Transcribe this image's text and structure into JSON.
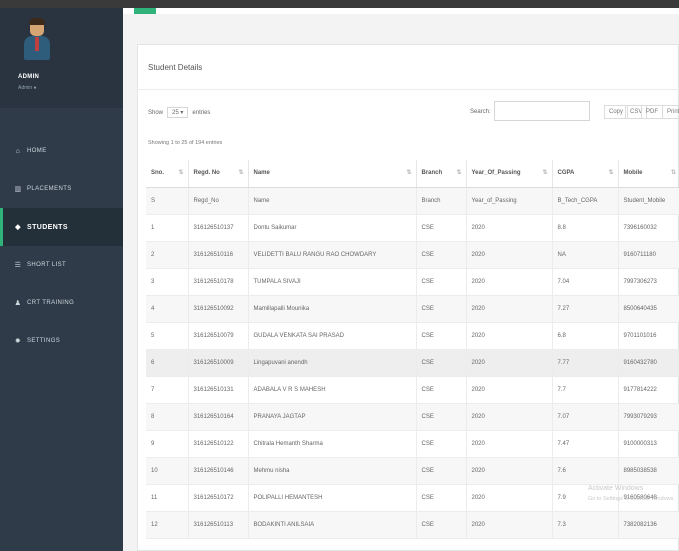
{
  "sidebar": {
    "profile": {
      "name": "ADMIN",
      "subtitle": "Admin ●"
    },
    "items": [
      {
        "label": "HOME",
        "icon": "home-icon",
        "glyph": "⌂"
      },
      {
        "label": "PLACEMENTS",
        "icon": "chart-icon",
        "glyph": "▥"
      },
      {
        "label": "STUDENTS",
        "icon": "graduation-cap-icon",
        "glyph": "◆"
      },
      {
        "label": "SHORT LIST",
        "icon": "list-icon",
        "glyph": "☰"
      },
      {
        "label": "CRT TRAINING",
        "icon": "user-icon",
        "glyph": "♟"
      },
      {
        "label": "SETTINGS",
        "icon": "gear-icon",
        "glyph": "✹"
      }
    ],
    "active_index": 2,
    "colors": {
      "background": "#2f3b48",
      "accent": "#2fb37a"
    }
  },
  "page": {
    "title": "Student Details",
    "show_prefix": "Show",
    "show_value": "25",
    "show_suffix": "entries",
    "search_label": "Search:",
    "search_value": "",
    "export_buttons": [
      "Copy",
      "CSV",
      "PDF",
      "Print"
    ],
    "showing_text": "Showing 1 to 25 of 194 entries"
  },
  "table": {
    "headers": [
      "Sno.",
      "Regd. No",
      "Name",
      "Branch",
      "Year_Of_Passing",
      "CGPA",
      "Mobile"
    ],
    "rows": [
      [
        "S",
        "Regd_No",
        "Name",
        "Branch",
        "Year_of_Passing",
        "B_Tech_CGPA",
        "Student_Mobile"
      ],
      [
        "1",
        "316126510137",
        "Dontu Saikumar",
        "CSE",
        "2020",
        "8.8",
        "7396160032"
      ],
      [
        "2",
        "316126510116",
        "VELIDETTI BALU RANGU RAO CHOWDARY",
        "CSE",
        "2020",
        "NA",
        "9160711180"
      ],
      [
        "3",
        "316126510178",
        "TUMPALA SIVAJI",
        "CSE",
        "2020",
        "7.04",
        "7997306273"
      ],
      [
        "4",
        "316126510092",
        "Mamillapalli Mounika",
        "CSE",
        "2020",
        "7.27",
        "8500640435"
      ],
      [
        "5",
        "316126510079",
        "GUDALA VENKATA SAI PRASAD",
        "CSE",
        "2020",
        "6.8",
        "9701101016"
      ],
      [
        "6",
        "316126510009",
        "Lingapuvani anendh",
        "CSE",
        "2020",
        "7.77",
        "9160432780"
      ],
      [
        "7",
        "316126510131",
        "ADABALA V R S MAHESH",
        "CSE",
        "2020",
        "7.7",
        "9177814222"
      ],
      [
        "8",
        "316126510164",
        "PRANAYA JAGTAP",
        "CSE",
        "2020",
        "7.07",
        "7993079293"
      ],
      [
        "9",
        "316126510122",
        "Chitrala Hemanth Sharma",
        "CSE",
        "2020",
        "7.47",
        "9100000313"
      ],
      [
        "10",
        "316126510146",
        "Mehmu nisha",
        "CSE",
        "2020",
        "7.6",
        "8985038538"
      ],
      [
        "11",
        "316126510172",
        "POLIPALLI HEMANTESH",
        "CSE",
        "2020",
        "7.9",
        "9160580648"
      ],
      [
        "12",
        "316126510113",
        "BODAKINTI ANILSAIA",
        "CSE",
        "2020",
        "7.3",
        "7382082136"
      ]
    ]
  },
  "watermark": {
    "line1": "Activate Windows",
    "line2": "Go to Settings to activate Windows."
  }
}
